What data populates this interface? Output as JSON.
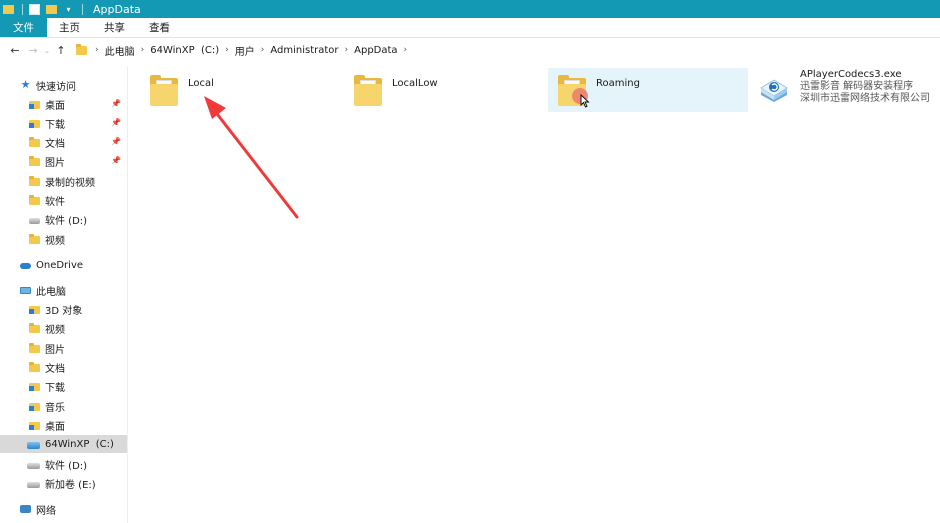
{
  "window": {
    "title": "AppData"
  },
  "ribbon": {
    "tabs": [
      "文件",
      "主页",
      "共享",
      "查看"
    ]
  },
  "address": {
    "crumbs": [
      "此电脑",
      "64WinXP  (C:)",
      "用户",
      "Administrator",
      "AppData"
    ],
    "back_icon": "arrow-left-icon",
    "forward_icon": "arrow-right-icon",
    "up_icon": "arrow-up-icon"
  },
  "sidebar": {
    "quick_access": "快速访问",
    "quick_items": [
      {
        "label": "桌面",
        "icon": "folder-blue-icon",
        "pinned": true
      },
      {
        "label": "下载",
        "icon": "download-icon",
        "pinned": true
      },
      {
        "label": "文档",
        "icon": "folder-icon",
        "pinned": true
      },
      {
        "label": "图片",
        "icon": "folder-icon",
        "pinned": true
      },
      {
        "label": "录制的视频",
        "icon": "folder-icon",
        "pinned": false
      },
      {
        "label": "软件",
        "icon": "folder-icon",
        "pinned": false
      },
      {
        "label": "软件 (D:)",
        "icon": "drive-icon",
        "pinned": false
      },
      {
        "label": "视频",
        "icon": "folder-icon",
        "pinned": false
      }
    ],
    "onedrive": "OneDrive",
    "this_pc": "此电脑",
    "pc_items": [
      {
        "label": "3D 对象",
        "icon": "folder-blue-icon"
      },
      {
        "label": "视频",
        "icon": "folder-icon"
      },
      {
        "label": "图片",
        "icon": "folder-icon"
      },
      {
        "label": "文档",
        "icon": "folder-icon"
      },
      {
        "label": "下载",
        "icon": "download-icon"
      },
      {
        "label": "音乐",
        "icon": "music-folder-icon"
      },
      {
        "label": "桌面",
        "icon": "folder-blue-icon"
      },
      {
        "label": "64WinXP  (C:)",
        "icon": "c-drive-icon",
        "selected": true
      },
      {
        "label": "软件 (D:)",
        "icon": "drive-icon"
      },
      {
        "label": "新加卷 (E:)",
        "icon": "drive-icon"
      }
    ],
    "network": "网络"
  },
  "content": {
    "items": [
      {
        "name": "Local",
        "type": "folder"
      },
      {
        "name": "LocalLow",
        "type": "folder"
      },
      {
        "name": "Roaming",
        "type": "folder",
        "hover": true
      },
      {
        "name": "APlayerCodecs3.exe",
        "type": "exe",
        "desc": "迅雷影音 解码器安装程序",
        "company": "深圳市迅雷网络技术有限公司"
      }
    ]
  },
  "colors": {
    "accent": "#1399b3",
    "hover": "#e5f3fb",
    "selected": "#d9d9d9",
    "arrow": "#f03a3a"
  }
}
